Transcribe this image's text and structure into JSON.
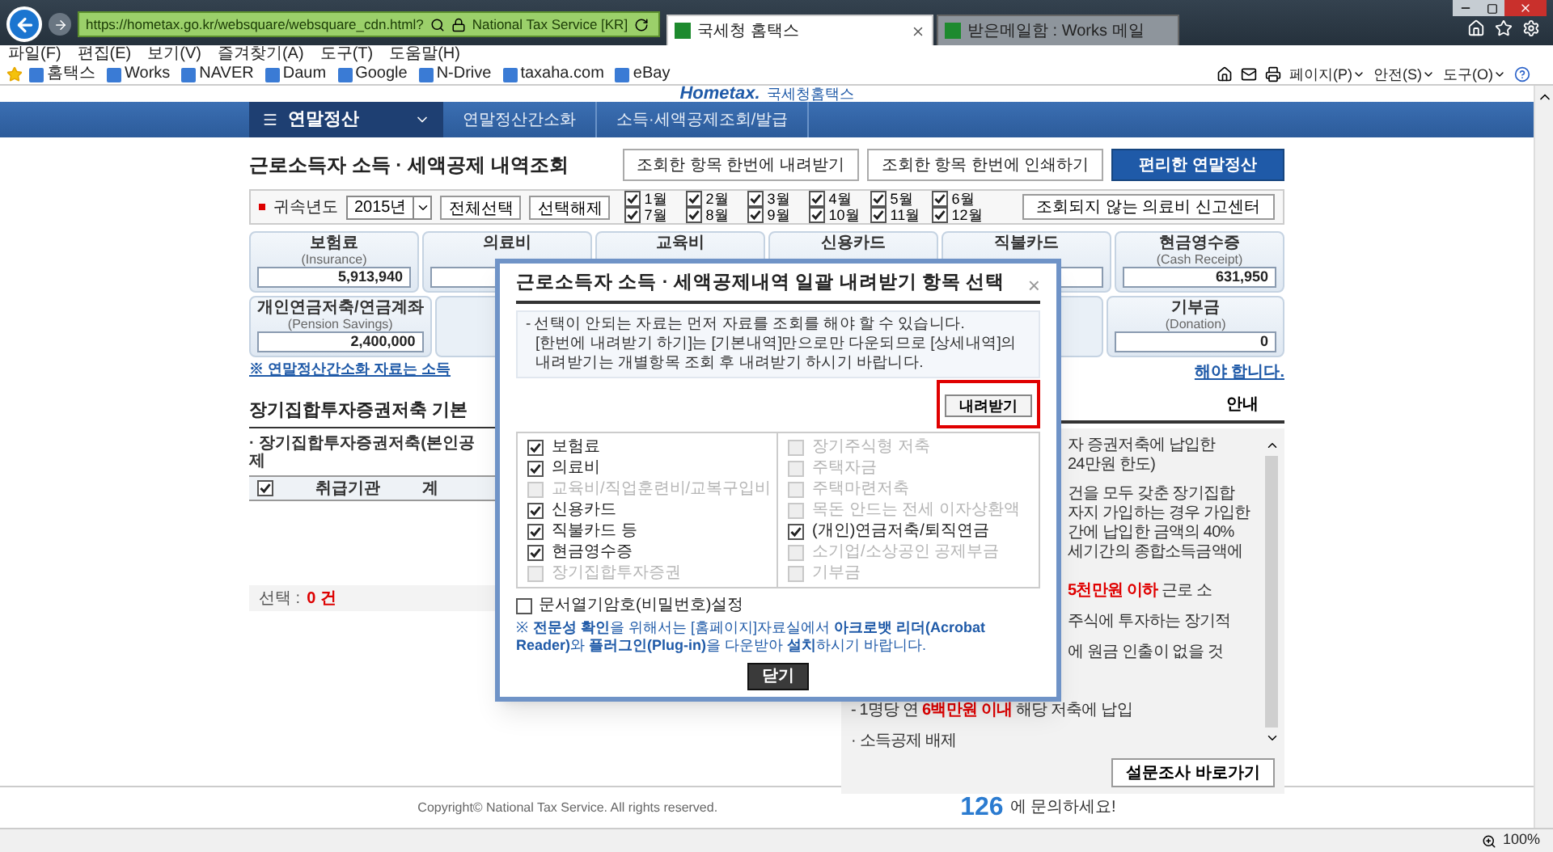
{
  "browser": {
    "address": "https://hometax.go.kr/websquare/websquare_cdn.html?",
    "site_identity": "National Tax Service [KR]",
    "tabs": [
      {
        "label": "국세청 홈택스",
        "selected": true
      },
      {
        "label": "받은메일함 : Works 메일",
        "selected": false
      }
    ],
    "menu": [
      "파일(F)",
      "편집(E)",
      "보기(V)",
      "즐겨찾기(A)",
      "도구(T)",
      "도움말(H)"
    ],
    "favorites": [
      "홈택스",
      "Works",
      "NAVER",
      "Daum",
      "Google",
      "N-Drive",
      "taxaha.com",
      "eBay"
    ],
    "command_menus": [
      "페이지(P)",
      "안전(S)",
      "도구(O)"
    ]
  },
  "header": {
    "logo": "Hometax.",
    "logo_sub": "국세청홈택스",
    "menu": "연말정산",
    "breadcrumbs": [
      "연말정산간소화",
      "소득·세액공제조회/발급"
    ]
  },
  "title": "근로소득자 소득 · 세액공제 내역조회",
  "actions": [
    {
      "label": "조회한 항목 한번에 내려받기",
      "primary": false
    },
    {
      "label": "조회한 항목 한번에 인쇄하기",
      "primary": false
    },
    {
      "label": "편리한 연말정산",
      "primary": true
    }
  ],
  "filter": {
    "label": "귀속년도",
    "year": "2015년",
    "buttons": [
      "전체선택",
      "선택해제"
    ],
    "months": [
      {
        "label": "1월",
        "checked": true
      },
      {
        "label": "2월",
        "checked": true
      },
      {
        "label": "3월",
        "checked": true
      },
      {
        "label": "4월",
        "checked": true
      },
      {
        "label": "5월",
        "checked": true
      },
      {
        "label": "6월",
        "checked": true
      },
      {
        "label": "7월",
        "checked": true
      },
      {
        "label": "8월",
        "checked": true
      },
      {
        "label": "9월",
        "checked": true
      },
      {
        "label": "10월",
        "checked": true
      },
      {
        "label": "11월",
        "checked": true
      },
      {
        "label": "12월",
        "checked": true
      }
    ],
    "report_button": "조회되지 않는 의료비 신고센터"
  },
  "cards_row_1": [
    {
      "label": "보험료",
      "sublabel": "(Insurance)",
      "value": "5,913,940"
    },
    {
      "label": "의료비"
    },
    {
      "label": "교육비"
    },
    {
      "label": "신용카드"
    },
    {
      "label": "직불카드"
    },
    {
      "label": "현금영수증",
      "sublabel": "(Cash Receipt)",
      "value": "631,950"
    }
  ],
  "cards_row_2": [
    {
      "label": "개인연금저축/연금계좌",
      "sublabel": "(Pension Savings)",
      "value": "2,400,000"
    },
    {
      "label": "기부금",
      "sublabel": "(Donation)",
      "value": "0"
    }
  ],
  "notice": {
    "start": "※ 연말정산간소화 자료는 소득",
    "end": "해야 합니다."
  },
  "section": {
    "title": "장기집합투자증권저축 기본",
    "tab": "안내",
    "subtitle": "· 장기집합투자증권저축(본인공제",
    "select_all_checked": true,
    "columns": [
      "취급기관",
      "계"
    ],
    "selection_label": "선택 :",
    "selection_count": "0 건"
  },
  "guide": {
    "lines": [
      {
        "parts": [
          {
            "text": "자 증권저축에 납입한",
            "em": false
          }
        ]
      },
      {
        "parts": [
          {
            "text": "24만원 한도)",
            "em": false
          }
        ]
      },
      {
        "parts": [
          {
            "text": "건을 모두 갖춘 장기집합",
            "em": false
          }
        ]
      },
      {
        "parts": [
          {
            "text": "자지 가입하는 경우 가입한",
            "em": false
          }
        ]
      },
      {
        "parts": [
          {
            "text": "간에 납입한 금액의 40%",
            "em": false
          }
        ]
      },
      {
        "parts": [
          {
            "text": "세기간의 종합소득금액에",
            "em": false
          }
        ]
      },
      {
        "parts": [
          {
            "text": "5천만원 이하",
            "em": true
          },
          {
            "text": " 근로 소",
            "em": false
          }
        ]
      },
      {
        "parts": [
          {
            "text": "주식에 투자하는 장기적",
            "em": false
          }
        ]
      },
      {
        "parts": [
          {
            "text": "에 원금 인출이 없을 것",
            "em": false
          }
        ]
      },
      {
        "parts": [
          {
            "text": "- 1명당 연 ",
            "em": false
          },
          {
            "text": "6백만원 이내",
            "em": true
          },
          {
            "text": " 해당 저축에 납입",
            "em": false
          }
        ]
      },
      {
        "parts": [
          {
            "text": "· 소득공제 배제",
            "em": false
          }
        ]
      }
    ],
    "survey_button": "설문조사 바로가기"
  },
  "footer": {
    "copyright": "Copyright© National Tax Service. All rights reserved.",
    "phone": "126",
    "phone_note": "에 문의하세요!"
  },
  "dialog": {
    "title": "근로소득자 소득 · 세액공제내역 일괄 내려받기 항목 선택",
    "close": "×",
    "notes": [
      "- 선택이 안되는 자료는 먼저 자료를 조회를 해야 할 수 있습니다.",
      "[한번에 내려받기 하기]는 [기본내역]만으로만 다운되므로 [상세내역]의 내려받기는 개별항목 조회 후 내려받기 하시기 바랍니다."
    ],
    "download_button": "내려받기",
    "items_left": [
      {
        "label": "보험료",
        "checked": true,
        "disabled": false
      },
      {
        "label": "의료비",
        "checked": true,
        "disabled": false
      },
      {
        "label": "교육비/직업훈련비/교복구입비",
        "checked": false,
        "disabled": true
      },
      {
        "label": "신용카드",
        "checked": true,
        "disabled": false
      },
      {
        "label": "직불카드 등",
        "checked": true,
        "disabled": false
      },
      {
        "label": "현금영수증",
        "checked": true,
        "disabled": false
      },
      {
        "label": "장기집합투자증권",
        "checked": false,
        "disabled": true
      }
    ],
    "items_right": [
      {
        "label": "장기주식형 저축",
        "checked": false,
        "disabled": true
      },
      {
        "label": "주택자금",
        "checked": false,
        "disabled": true
      },
      {
        "label": "주택마련저축",
        "checked": false,
        "disabled": true
      },
      {
        "label": "목돈 안드는 전세 이자상환액",
        "checked": false,
        "disabled": true
      },
      {
        "label": "(개인)연금저축/퇴직연금",
        "checked": true,
        "disabled": false
      },
      {
        "label": "소기업/소상공인 공제부금",
        "checked": false,
        "disabled": true
      },
      {
        "label": "기부금",
        "checked": false,
        "disabled": true
      }
    ],
    "password": {
      "label": "문서열기암호(비밀번호)설정",
      "checked": false
    },
    "note": "※ **전문성 확인**을 위해서는 [홈페이지]자료실에서 **아크로뱃 리더(Acrobat Reader)**와 **플러그인(Plug-in)**을 다운받아 **설치**하시기 바랍니다.",
    "close_button": "닫기"
  },
  "status_bar": {
    "zoom": "100%"
  }
}
